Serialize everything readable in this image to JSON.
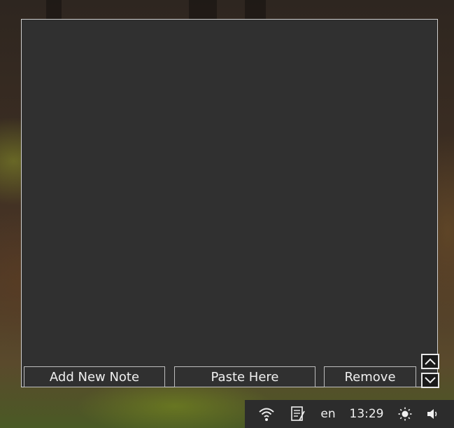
{
  "notes_window": {
    "note_text": "",
    "buttons": {
      "add_label": "Add New Note",
      "paste_label": "Paste Here",
      "remove_label": "Remove"
    }
  },
  "taskbar": {
    "icons": [
      "wifi-icon",
      "notes-icon",
      "brightness-icon",
      "volume-icon"
    ],
    "language": "en",
    "clock": "13:29"
  }
}
